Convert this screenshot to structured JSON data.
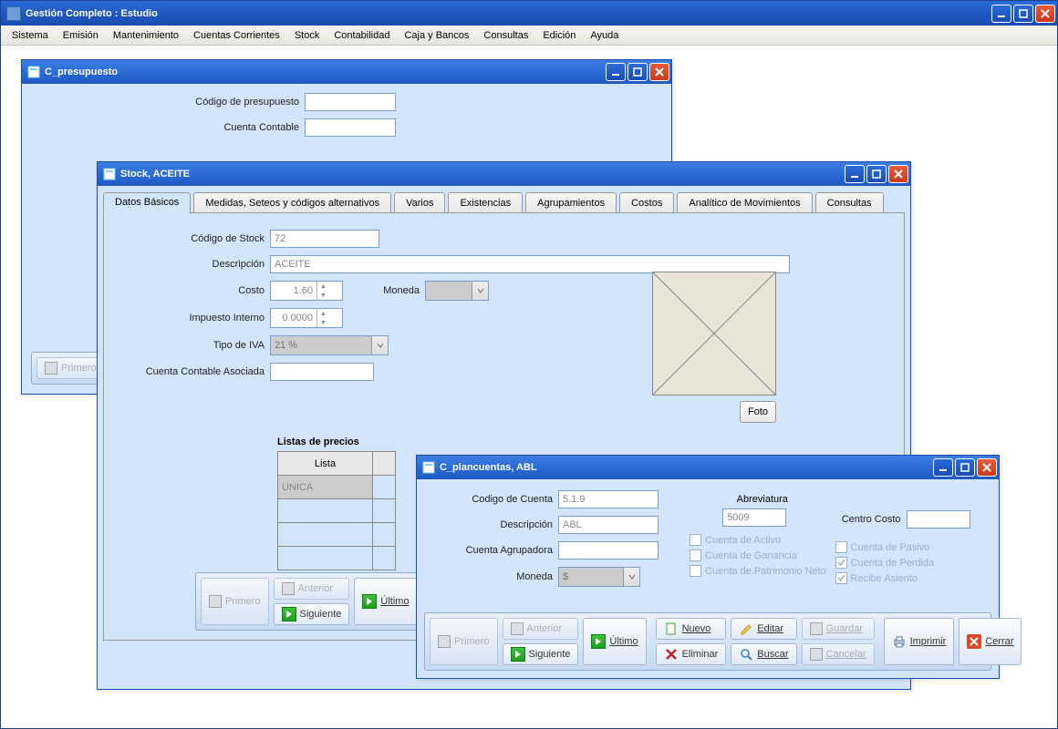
{
  "app": {
    "title": "Gestión Completo : Estudio"
  },
  "menu": [
    "Sistema",
    "Emisión",
    "Mantenimiento",
    "Cuentas Corrientes",
    "Stock",
    "Contabilidad",
    "Caja y Bancos",
    "Consultas",
    "Edición",
    "Ayuda"
  ],
  "presupuesto": {
    "title": "C_presupuesto",
    "codigo_label": "Código de presupuesto",
    "cuenta_label": "Cuenta Contable",
    "codigo": "",
    "cuenta": "",
    "nav": {
      "primero": "Primero"
    }
  },
  "stock": {
    "title": "Stock, ACEITE",
    "tabs": [
      "Datos Básicos",
      "Medidas, Seteos y códigos alternativos",
      "Varios",
      "Existencias",
      "Agrupamientos",
      "Costos",
      "Analítico de Movimientos",
      "Consultas"
    ],
    "labels": {
      "codigo": "Código de Stock",
      "desc": "Descripción",
      "costo": "Costo",
      "moneda": "Moneda",
      "impuesto": "Impuesto Interno",
      "tipo_iva": "Tipo de IVA",
      "cuenta": "Cuenta Contable Asociada",
      "foto": "Foto",
      "listas": "Listas de precios",
      "th_lista": "Lista"
    },
    "codigo": "72",
    "desc": "ACEITE",
    "costo": "1.60",
    "moneda": "",
    "impuesto": "0.0000",
    "tipo_iva": "21 %",
    "cuenta": "",
    "price_row0": "UNICA",
    "nav": {
      "primero": "Primero",
      "anterior": "Anterior",
      "siguiente": "Siguiente",
      "ultimo": "Último"
    }
  },
  "plan": {
    "title": "C_plancuentas, ABL",
    "labels": {
      "codigo": "Codigo de Cuenta",
      "desc": "Descripción",
      "agrup": "Cuenta Agrupadora",
      "moneda": "Moneda",
      "abrev": "Abreviatura",
      "centro": "Centro Costo"
    },
    "codigo": "5.1.9",
    "desc": "ABL",
    "agrup": "",
    "moneda": "$",
    "abrev": "5009",
    "centro": "",
    "checks": {
      "activo": "Cuenta de Activo",
      "ganancia": "Cuenta de Ganancia",
      "patrimonio": "Cuenta de Patrimonio Neto",
      "pasivo": "Cuenta de Pasivo",
      "perdida": "Cuenta de Perdida",
      "recibe": "Recibe Asiento"
    },
    "nav": {
      "primero": "Primero",
      "anterior": "Anterior",
      "siguiente": "Siguiente",
      "ultimo": "Último"
    },
    "btns": {
      "nuevo": "Nuevo",
      "editar": "Editar",
      "guardar": "Guardar",
      "eliminar": "Eliminar",
      "buscar": "Buscar",
      "cancelar": "Cancelar",
      "imprimir": "Imprimir",
      "cerrar": "Cerrar"
    }
  }
}
